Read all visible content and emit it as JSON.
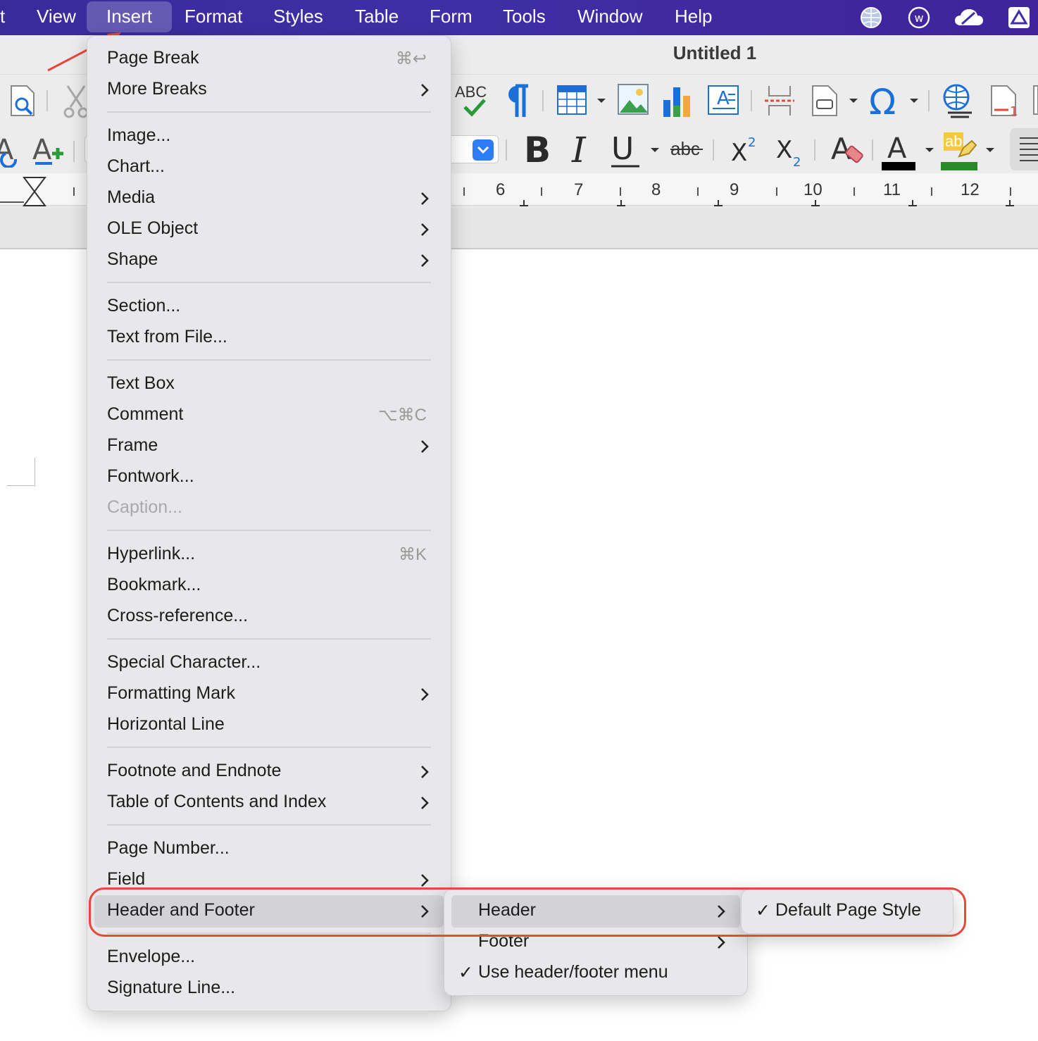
{
  "menubar": {
    "items": [
      {
        "label": "t"
      },
      {
        "label": "View"
      },
      {
        "label": "Insert"
      },
      {
        "label": "Format"
      },
      {
        "label": "Styles"
      },
      {
        "label": "Table"
      },
      {
        "label": "Form"
      },
      {
        "label": "Tools"
      },
      {
        "label": "Window"
      },
      {
        "label": "Help"
      }
    ],
    "status_icons": [
      "globe-icon",
      "w-circle-icon",
      "cloud-icon",
      "drive-icon"
    ]
  },
  "window": {
    "title": "Untitled 1"
  },
  "ruler": {
    "numbers": [
      "6",
      "7",
      "8",
      "9",
      "10",
      "11",
      "12"
    ]
  },
  "insert_menu": {
    "items": [
      {
        "label": "Page Break",
        "shortcut": "⌘↩"
      },
      {
        "label": "More Breaks"
      },
      {
        "label": "Image..."
      },
      {
        "label": "Chart..."
      },
      {
        "label": "Media"
      },
      {
        "label": "OLE Object"
      },
      {
        "label": "Shape"
      },
      {
        "label": "Section..."
      },
      {
        "label": "Text from File..."
      },
      {
        "label": "Text Box"
      },
      {
        "label": "Comment",
        "shortcut": "⌥⌘C"
      },
      {
        "label": "Frame"
      },
      {
        "label": "Fontwork..."
      },
      {
        "label": "Caption..."
      },
      {
        "label": "Hyperlink...",
        "shortcut": "⌘K"
      },
      {
        "label": "Bookmark..."
      },
      {
        "label": "Cross-reference..."
      },
      {
        "label": "Special Character..."
      },
      {
        "label": "Formatting Mark"
      },
      {
        "label": "Horizontal Line"
      },
      {
        "label": "Footnote and Endnote"
      },
      {
        "label": "Table of Contents and Index"
      },
      {
        "label": "Page Number..."
      },
      {
        "label": "Field"
      },
      {
        "label": "Header and Footer"
      },
      {
        "label": "Envelope..."
      },
      {
        "label": "Signature Line..."
      }
    ]
  },
  "header_footer_menu": {
    "items": [
      {
        "label": "Header"
      },
      {
        "label": "Footer"
      },
      {
        "label": "Use header/footer menu",
        "check": "✓"
      }
    ]
  },
  "header_submenu": {
    "items": [
      {
        "label": "Default Page Style",
        "check": "✓"
      }
    ]
  },
  "toolbar": {
    "spellcheck_label": "ABC",
    "strike_label": "abc",
    "highlight_label": "ab"
  },
  "colors": {
    "menubar": "#3f2fa6",
    "highlight_ring": "#e8473c",
    "arrow": "#e8473c"
  }
}
